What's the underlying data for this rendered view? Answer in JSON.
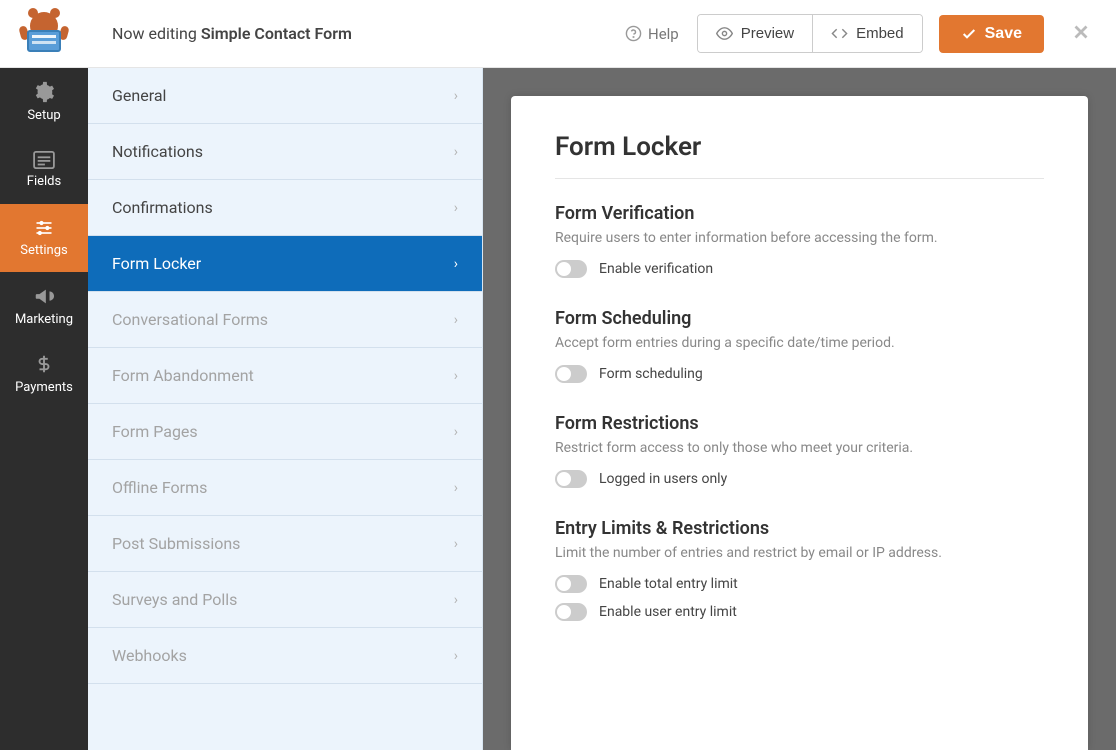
{
  "topbar": {
    "editing_prefix": "Now editing ",
    "form_name": "Simple Contact Form",
    "help_label": "Help",
    "preview_label": "Preview",
    "embed_label": "Embed",
    "save_label": "Save"
  },
  "sidebar": {
    "items": [
      {
        "id": "setup",
        "label": "Setup",
        "active": false
      },
      {
        "id": "fields",
        "label": "Fields",
        "active": false
      },
      {
        "id": "settings",
        "label": "Settings",
        "active": true
      },
      {
        "id": "marketing",
        "label": "Marketing",
        "active": false
      },
      {
        "id": "payments",
        "label": "Payments",
        "active": false
      }
    ]
  },
  "submenu": {
    "items": [
      {
        "label": "General",
        "active": false,
        "muted": false
      },
      {
        "label": "Notifications",
        "active": false,
        "muted": false
      },
      {
        "label": "Confirmations",
        "active": false,
        "muted": false
      },
      {
        "label": "Form Locker",
        "active": true,
        "muted": false
      },
      {
        "label": "Conversational Forms",
        "active": false,
        "muted": true
      },
      {
        "label": "Form Abandonment",
        "active": false,
        "muted": true
      },
      {
        "label": "Form Pages",
        "active": false,
        "muted": true
      },
      {
        "label": "Offline Forms",
        "active": false,
        "muted": true
      },
      {
        "label": "Post Submissions",
        "active": false,
        "muted": true
      },
      {
        "label": "Surveys and Polls",
        "active": false,
        "muted": true
      },
      {
        "label": "Webhooks",
        "active": false,
        "muted": true
      }
    ]
  },
  "panel": {
    "title": "Form Locker",
    "sections": [
      {
        "heading": "Form Verification",
        "description": "Require users to enter information before accessing the form.",
        "toggles": [
          {
            "label": "Enable verification",
            "on": false
          }
        ]
      },
      {
        "heading": "Form Scheduling",
        "description": "Accept form entries during a specific date/time period.",
        "toggles": [
          {
            "label": "Form scheduling",
            "on": false
          }
        ]
      },
      {
        "heading": "Form Restrictions",
        "description": "Restrict form access to only those who meet your criteria.",
        "toggles": [
          {
            "label": "Logged in users only",
            "on": false
          }
        ]
      },
      {
        "heading": "Entry Limits & Restrictions",
        "description": "Limit the number of entries and restrict by email or IP address.",
        "toggles": [
          {
            "label": "Enable total entry limit",
            "on": false
          },
          {
            "label": "Enable user entry limit",
            "on": false
          }
        ]
      }
    ]
  }
}
